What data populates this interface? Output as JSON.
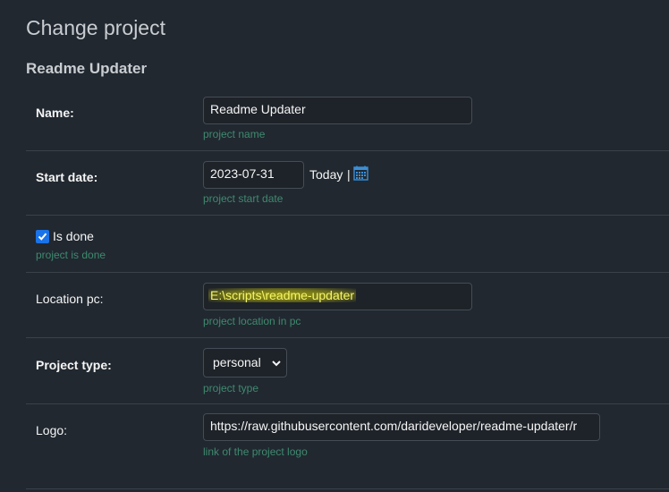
{
  "page": {
    "title": "Change project"
  },
  "module": {
    "caption": "Readme Updater"
  },
  "fields": {
    "name": {
      "label": "Name:",
      "value": "Readme Updater",
      "help": "project name"
    },
    "start_date": {
      "label": "Start date:",
      "value": "2023-07-31",
      "today": "Today",
      "separator": "|",
      "help": "project start date"
    },
    "is_done": {
      "label": "Is done",
      "checked": true,
      "help": "project is done"
    },
    "location_pc": {
      "label": "Location pc:",
      "value": "E:\\scripts\\readme-updater",
      "help": "project location in pc"
    },
    "project_type": {
      "label": "Project type:",
      "selected": "personal",
      "help": "project type"
    },
    "logo": {
      "label": "Logo:",
      "value": "https://raw.githubusercontent.com/darideveloper/readme-updater/r",
      "help": "link of the project logo"
    }
  },
  "icons": {
    "calendar": "calendar-icon",
    "checkmark": "checkmark-icon",
    "select_arrow": "chevron-down-icon"
  },
  "colors": {
    "background": "#212830",
    "help_text": "#3f8a6f",
    "checkbox": "#1a73e8",
    "highlight": "#fffb00"
  }
}
